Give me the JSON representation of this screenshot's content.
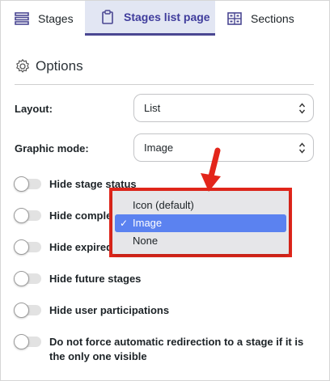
{
  "tabs": [
    {
      "label": "Stages",
      "icon": "list-icon"
    },
    {
      "label": "Stages list page",
      "icon": "clipboard-icon",
      "active": true
    },
    {
      "label": "Sections",
      "icon": "grid-icon"
    }
  ],
  "panel": {
    "title": "Options",
    "icon": "gear-icon"
  },
  "fields": {
    "layout": {
      "label": "Layout:",
      "value": "List"
    },
    "graphic_mode": {
      "label": "Graphic mode:",
      "value": "Image"
    }
  },
  "toggles": [
    {
      "label": "Hide stage status",
      "on": false
    },
    {
      "label": "Hide comple",
      "on": false
    },
    {
      "label": "Hide expired",
      "on": false
    },
    {
      "label": "Hide future stages",
      "on": false
    },
    {
      "label": "Hide user participations",
      "on": false
    },
    {
      "label": "Do not force automatic redirection to a stage if it is the only one visible",
      "on": false
    }
  ],
  "dropdown": {
    "options": [
      "Icon (default)",
      "Image",
      "None"
    ],
    "selected": "Image",
    "check_glyph": "✓"
  },
  "colors": {
    "accent": "#4a4792",
    "tab_active_bg": "#e2e6f3",
    "highlight": "#e3261b",
    "option_selected": "#5b82f0"
  }
}
